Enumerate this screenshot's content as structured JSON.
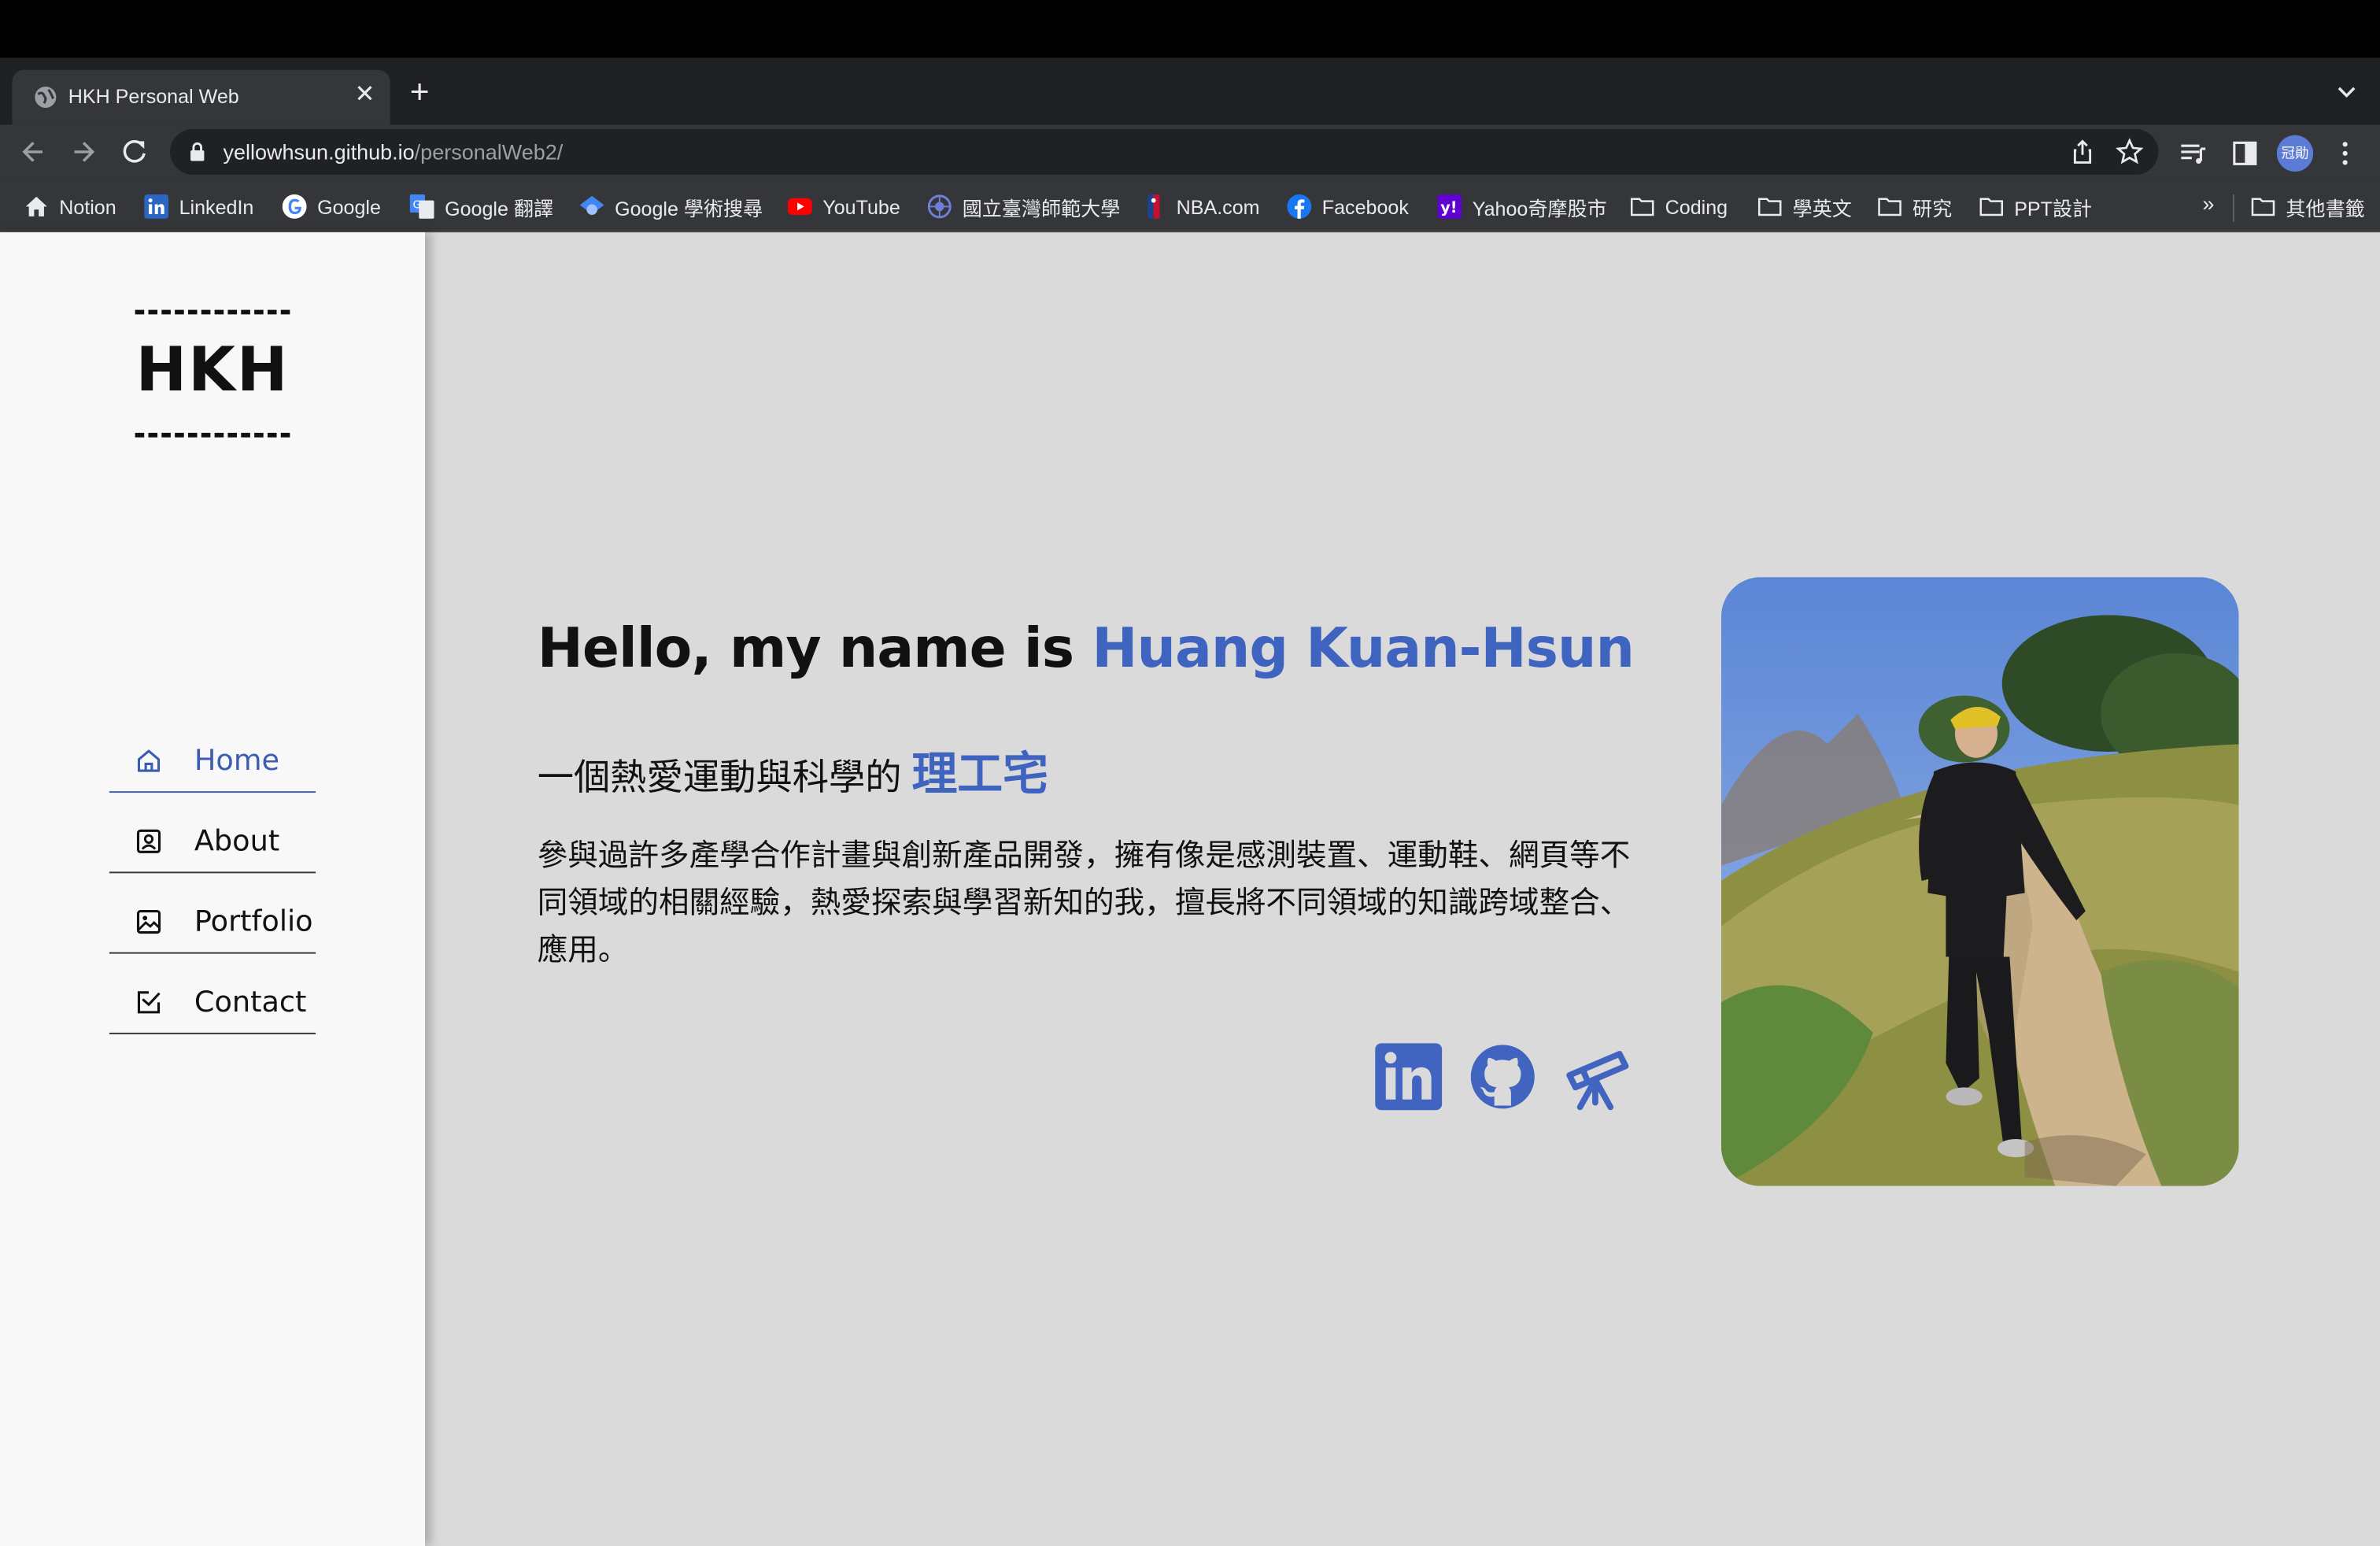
{
  "browser": {
    "tab_title": "HKH Personal Web",
    "url_host": "yellowhsun.github.io",
    "url_path": "/personalWeb2/",
    "profile_initials": "冠勛",
    "bookmarks": [
      {
        "label": "Notion",
        "icon": "notion-icon"
      },
      {
        "label": "LinkedIn",
        "icon": "linkedin-icon"
      },
      {
        "label": "Google",
        "icon": "google-icon"
      },
      {
        "label": "Google 翻譯",
        "icon": "google-translate-icon"
      },
      {
        "label": "Google 學術搜尋",
        "icon": "google-scholar-icon"
      },
      {
        "label": "YouTube",
        "icon": "youtube-icon"
      },
      {
        "label": "國立臺灣師範大學",
        "icon": "ntnu-icon"
      },
      {
        "label": "NBA.com",
        "icon": "nba-icon"
      },
      {
        "label": "Facebook",
        "icon": "facebook-icon"
      },
      {
        "label": "Yahoo奇摩股市",
        "icon": "yahoo-icon"
      },
      {
        "label": "Coding",
        "icon": "folder-icon"
      },
      {
        "label": "學英文",
        "icon": "folder-icon"
      },
      {
        "label": "研究",
        "icon": "folder-icon"
      },
      {
        "label": "PPT設計",
        "icon": "folder-icon"
      }
    ],
    "more_bookmarks": "»",
    "other_bookmarks": "其他書籤"
  },
  "site": {
    "logo": "HKH",
    "nav": [
      {
        "label": "Home",
        "icon": "home-icon",
        "active": true
      },
      {
        "label": "About",
        "icon": "user-card-icon",
        "active": false
      },
      {
        "label": "Portfolio",
        "icon": "image-icon",
        "active": false
      },
      {
        "label": "Contact",
        "icon": "contact-edit-icon",
        "active": false
      }
    ],
    "hero": {
      "greeting": "Hello, my name is ",
      "name": "Huang Kuan-Hsun",
      "subtitle_prefix": "一個熱愛運動與科學的 ",
      "subtitle_highlight": "理工宅",
      "description": "參與過許多產學合作計畫與創新產品開發，擁有像是感測裝置、運動鞋、網頁等不同領域的相關經驗，熱愛探索與學習新知的我，擅長將不同領域的知識跨域整合、應用。"
    },
    "social": [
      "linkedin-icon",
      "github-icon",
      "telescope-icon"
    ],
    "colors": {
      "accent": "#3f64c0",
      "background": "#dadada",
      "sidebar": "#f8f8f8"
    }
  }
}
